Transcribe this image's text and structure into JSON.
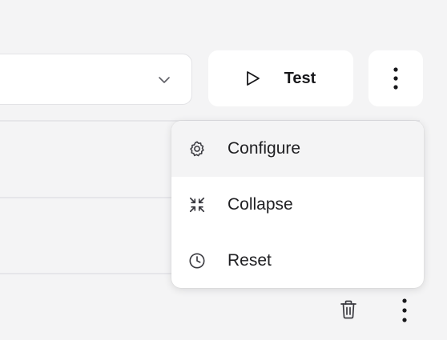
{
  "toolbar": {
    "select": {
      "value": "",
      "icon": "chevron-down-icon"
    },
    "test_button": {
      "label": "Test",
      "icon": "play-icon"
    },
    "more_button": {
      "icon": "more-vertical-icon"
    }
  },
  "menu": {
    "items": [
      {
        "label": "Configure",
        "icon": "gear-icon",
        "highlighted": true
      },
      {
        "label": "Collapse",
        "icon": "collapse-icon",
        "highlighted": false
      },
      {
        "label": "Reset",
        "icon": "clock-icon",
        "highlighted": false
      }
    ]
  },
  "row_actions": {
    "delete_icon": "trash-icon",
    "more_icon": "more-vertical-icon"
  },
  "colors": {
    "background": "#f4f4f5",
    "surface": "#ffffff",
    "border": "#e3e3e6",
    "text": "#1f1f22",
    "menu_highlight": "#f4f4f5"
  }
}
